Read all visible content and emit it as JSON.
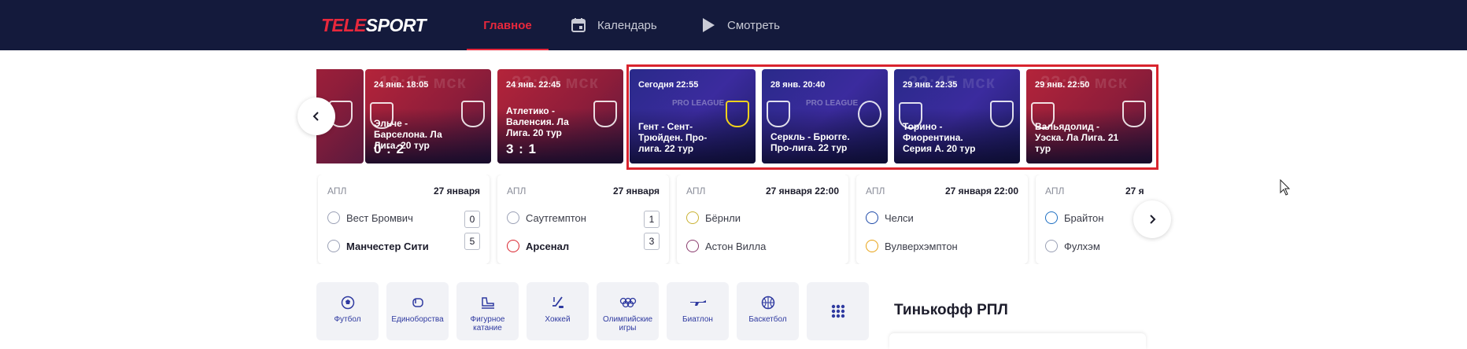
{
  "header": {
    "logo_left": "TELE",
    "logo_right": "SPORT",
    "nav": [
      {
        "label": "Главное",
        "active": true
      },
      {
        "label": "Календарь",
        "icon": "calendar-icon"
      },
      {
        "label": "Смотреть",
        "icon": "play-icon"
      }
    ]
  },
  "carousel": {
    "cards": [
      {
        "date": "",
        "title": "",
        "score": "",
        "theme": "red"
      },
      {
        "date": "24 янв. 18:05",
        "big_time": "18:15 мск",
        "title": "Эльче - Барселона. Ла Лига. 20 тур",
        "score": "0 : 2",
        "theme": "red"
      },
      {
        "date": "24 янв. 22:45",
        "big_time": "23:00 мск",
        "title": "Атлетико - Валенсия. Ла Лига. 20 тур",
        "score": "3 : 1",
        "theme": "red"
      },
      {
        "date": "Сегодня 22:55",
        "title": "Гент - Сент-Трюйден. Про-лига. 22 тур",
        "score": "",
        "theme": "blue",
        "league": "PRO LEAGUE"
      },
      {
        "date": "28 янв. 20:40",
        "title": "Серкль - Брюгге. Про-лига. 22 тур",
        "score": "",
        "theme": "blue",
        "league": "PRO LEAGUE"
      },
      {
        "date": "29 янв. 22:35",
        "big_time": "22:45 мск",
        "title": "Торино - Фиорентина. Серия А. 20 тур",
        "score": "",
        "theme": "blue"
      },
      {
        "date": "29 янв. 22:50",
        "big_time": "23:00 мск",
        "title": "Вальядолид - Уэска. Ла Лига. 21 тур",
        "score": "",
        "theme": "red"
      }
    ]
  },
  "matches": [
    {
      "league": "АПЛ",
      "date": "27 января",
      "home": "Вест Бромвич",
      "away": "Манчестер Сити",
      "home_score": "0",
      "away_score": "5",
      "winner": "away"
    },
    {
      "league": "АПЛ",
      "date": "27 января",
      "home": "Саутгемптон",
      "away": "Арсенал",
      "home_score": "1",
      "away_score": "3",
      "winner": "away"
    },
    {
      "league": "АПЛ",
      "date": "27 января 22:00",
      "home": "Бёрнли",
      "away": "Астон Вилла",
      "home_score": "",
      "away_score": "",
      "winner": ""
    },
    {
      "league": "АПЛ",
      "date": "27 января 22:00",
      "home": "Челси",
      "away": "Вулверхэмптон",
      "home_score": "",
      "away_score": "",
      "winner": ""
    },
    {
      "league": "АПЛ",
      "date": "27 я",
      "home": "Брайтон",
      "away": "Фулхэм",
      "home_score": "",
      "away_score": "",
      "winner": ""
    }
  ],
  "sports": [
    {
      "label": "Футбол",
      "icon": "football-icon"
    },
    {
      "label": "Единоборства",
      "icon": "boxing-glove-icon"
    },
    {
      "label": "Фигурное катание",
      "icon": "skate-icon"
    },
    {
      "label": "Хоккей",
      "icon": "hockey-icon"
    },
    {
      "label": "Олимпийские игры",
      "icon": "olympic-rings-icon"
    },
    {
      "label": "Биатлон",
      "icon": "rifle-icon"
    },
    {
      "label": "Баскетбол",
      "icon": "basketball-icon"
    },
    {
      "label": "",
      "icon": "grid-icon"
    }
  ],
  "section": {
    "title": "Тинькофф РПЛ"
  },
  "colors": {
    "header_bg": "#141a3c",
    "accent": "#e8283c",
    "tile_text": "#2f3aa0",
    "highlight": "#d9242e"
  }
}
